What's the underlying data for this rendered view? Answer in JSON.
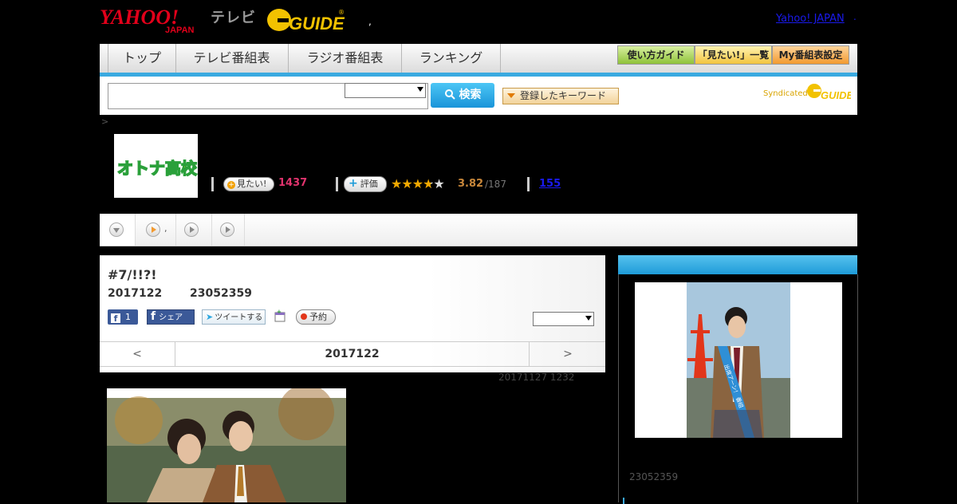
{
  "header": {
    "yahoo_logo": "YAHOO! JAPAN",
    "tv_label": "テレビ",
    "gguide_logo": "G GUIDE",
    "dot": ",",
    "yahoo_japan_link": "Yahoo! JAPAN",
    "link_dot": "."
  },
  "nav": {
    "tabs": [
      "トップ",
      "テレビ番組表",
      "ラジオ番組表",
      "ランキング"
    ],
    "util_buttons": [
      "使い方ガイド",
      "「見たい!」一覧",
      "My番組表設定"
    ]
  },
  "search": {
    "placeholder": "",
    "button_label": "検索",
    "keyword_button": "登録したキーワード",
    "syndicated": "Syndicated"
  },
  "breadcrumb": {
    "arrow": ">"
  },
  "program": {
    "thumb_title": "オトナ高校",
    "want_label": "見たい!",
    "want_count": "1437",
    "rate_label": "評価",
    "rating": "3.82",
    "rating_count": "/187",
    "rating_stars_filled": 3.82,
    "review_count": "155"
  },
  "subtabs": {
    "dot": ","
  },
  "episode": {
    "title": "#7/!!?!",
    "date": "2017122",
    "code": "23052359",
    "fb_like_count": "1",
    "fb_share": "シェア",
    "tweet": "ツイートする",
    "reserve": "予約",
    "pager_prev": "<",
    "pager_current": "2017122",
    "pager_next": ">",
    "updated": "20171127  1232"
  },
  "sidebar": {
    "cast_code": "23052359",
    "sash_text": "出席アーン！ 番組"
  },
  "colors": {
    "accent_blue": "#3aaae0",
    "want_pink": "#e0336d",
    "rating_orange": "#c8873a",
    "link_blue": "#1a1aee"
  }
}
